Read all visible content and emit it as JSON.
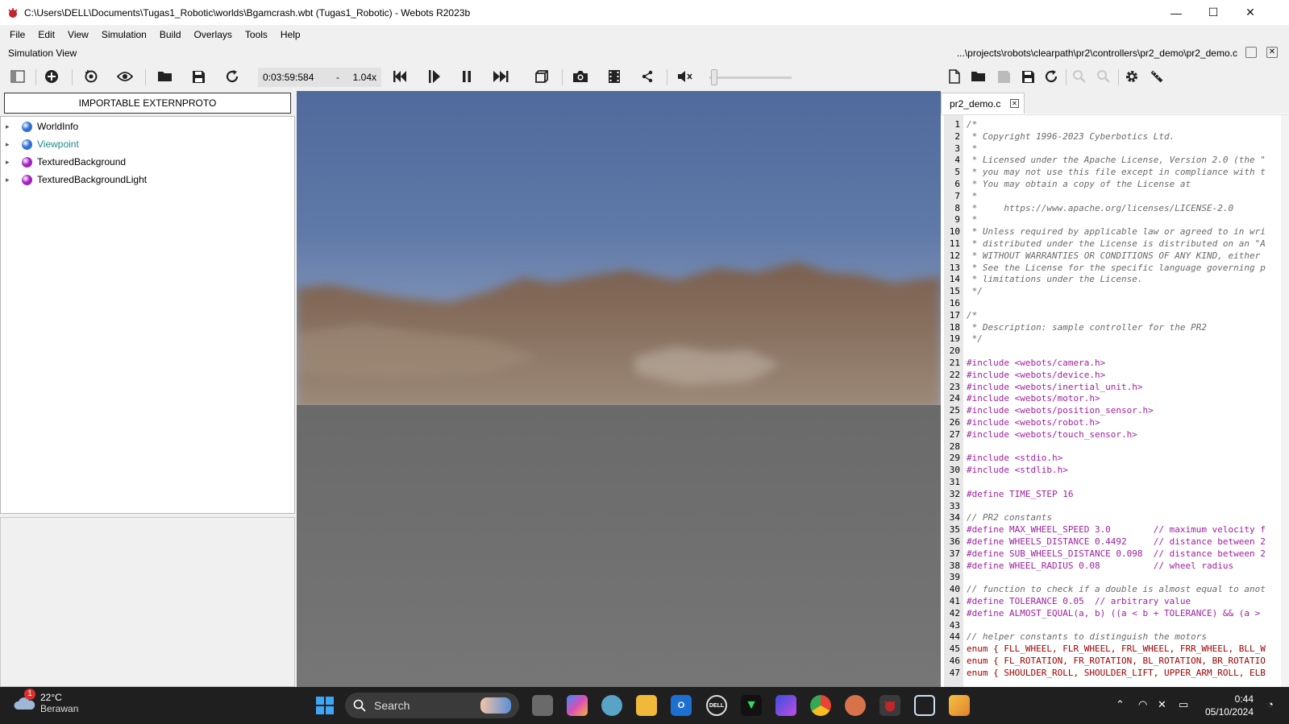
{
  "window": {
    "title": "C:\\Users\\DELL\\Documents\\Tugas1_Robotic\\worlds\\Bgamcrash.wbt (Tugas1_Robotic) - Webots R2023b",
    "minimize": "—",
    "maximize": "☐",
    "close": "✕"
  },
  "menu": [
    "File",
    "Edit",
    "View",
    "Simulation",
    "Build",
    "Overlays",
    "Tools",
    "Help"
  ],
  "simulation_view_label": "Simulation View",
  "editor_path": "...\\projects\\robots\\clearpath\\pr2\\controllers\\pr2_demo\\pr2_demo.c",
  "toolbar": {
    "time": "0:03:59:584",
    "dash": "-",
    "speed": "1.04x",
    "volume_level": 0.02
  },
  "scene_tree": {
    "externproto_button": "IMPORTABLE EXTERNPROTO",
    "items": [
      {
        "label": "WorldInfo",
        "ball_color": "#2f6fd6",
        "label_color": "#000000"
      },
      {
        "label": "Viewpoint",
        "ball_color": "#2f6fd6",
        "label_color": "#1f8a8a"
      },
      {
        "label": "TexturedBackground",
        "ball_color": "#a020c0",
        "label_color": "#000000"
      },
      {
        "label": "TexturedBackgroundLight",
        "ball_color": "#a020c0",
        "label_color": "#000000"
      }
    ]
  },
  "editor": {
    "tab_label": "pr2_demo.c",
    "lines": [
      {
        "n": "1",
        "t": "/*",
        "k": "comment"
      },
      {
        "n": "2",
        "t": " * Copyright 1996-2023 Cyberbotics Ltd.",
        "k": "comment"
      },
      {
        "n": "3",
        "t": " *",
        "k": "comment"
      },
      {
        "n": "4",
        "t": " * Licensed under the Apache License, Version 2.0 (the \"",
        "k": "comment"
      },
      {
        "n": "5",
        "t": " * you may not use this file except in compliance with t",
        "k": "comment"
      },
      {
        "n": "6",
        "t": " * You may obtain a copy of the License at",
        "k": "comment"
      },
      {
        "n": "7",
        "t": " *",
        "k": "comment"
      },
      {
        "n": "8",
        "t": " *     https://www.apache.org/licenses/LICENSE-2.0",
        "k": "comment"
      },
      {
        "n": "9",
        "t": " *",
        "k": "comment"
      },
      {
        "n": "10",
        "t": " * Unless required by applicable law or agreed to in wri",
        "k": "comment"
      },
      {
        "n": "11",
        "t": " * distributed under the License is distributed on an \"A",
        "k": "comment"
      },
      {
        "n": "12",
        "t": " * WITHOUT WARRANTIES OR CONDITIONS OF ANY KIND, either",
        "k": "comment"
      },
      {
        "n": "13",
        "t": " * See the License for the specific language governing p",
        "k": "comment"
      },
      {
        "n": "14",
        "t": " * limitations under the License.",
        "k": "comment"
      },
      {
        "n": "15",
        "t": " */",
        "k": "comment"
      },
      {
        "n": "16",
        "t": "",
        "k": "plain"
      },
      {
        "n": "17",
        "t": "/*",
        "k": "comment"
      },
      {
        "n": "18",
        "t": " * Description: sample controller for the PR2",
        "k": "comment"
      },
      {
        "n": "19",
        "t": " */",
        "k": "comment"
      },
      {
        "n": "20",
        "t": "",
        "k": "plain"
      },
      {
        "n": "21",
        "t": "#include <webots/camera.h>",
        "k": "pp"
      },
      {
        "n": "22",
        "t": "#include <webots/device.h>",
        "k": "pp"
      },
      {
        "n": "23",
        "t": "#include <webots/inertial_unit.h>",
        "k": "pp"
      },
      {
        "n": "24",
        "t": "#include <webots/motor.h>",
        "k": "pp"
      },
      {
        "n": "25",
        "t": "#include <webots/position_sensor.h>",
        "k": "pp"
      },
      {
        "n": "26",
        "t": "#include <webots/robot.h>",
        "k": "pp"
      },
      {
        "n": "27",
        "t": "#include <webots/touch_sensor.h>",
        "k": "pp"
      },
      {
        "n": "28",
        "t": "",
        "k": "plain"
      },
      {
        "n": "29",
        "t": "#include <stdio.h>",
        "k": "pp"
      },
      {
        "n": "30",
        "t": "#include <stdlib.h>",
        "k": "pp"
      },
      {
        "n": "31",
        "t": "",
        "k": "plain"
      },
      {
        "n": "32",
        "t": "#define TIME_STEP 16",
        "k": "pp"
      },
      {
        "n": "33",
        "t": "",
        "k": "plain"
      },
      {
        "n": "34",
        "t": "// PR2 constants",
        "k": "comment"
      },
      {
        "n": "35",
        "t": "#define MAX_WHEEL_SPEED 3.0        // maximum velocity f",
        "k": "pp"
      },
      {
        "n": "36",
        "t": "#define WHEELS_DISTANCE 0.4492     // distance between 2",
        "k": "pp"
      },
      {
        "n": "37",
        "t": "#define SUB_WHEELS_DISTANCE 0.098  // distance between 2",
        "k": "pp"
      },
      {
        "n": "38",
        "t": "#define WHEEL_RADIUS 0.08          // wheel radius",
        "k": "pp"
      },
      {
        "n": "39",
        "t": "",
        "k": "plain"
      },
      {
        "n": "40",
        "t": "// function to check if a double is almost equal to anot",
        "k": "comment"
      },
      {
        "n": "41",
        "t": "#define TOLERANCE 0.05  // arbitrary value",
        "k": "pp"
      },
      {
        "n": "42",
        "t": "#define ALMOST_EQUAL(a, b) ((a < b + TOLERANCE) && (a >",
        "k": "pp"
      },
      {
        "n": "43",
        "t": "",
        "k": "plain"
      },
      {
        "n": "44",
        "t": "// helper constants to distinguish the motors",
        "k": "comment"
      },
      {
        "n": "45",
        "t": "enum { FLL_WHEEL, FLR_WHEEL, FRL_WHEEL, FRR_WHEEL, BLL_W",
        "k": "enum"
      },
      {
        "n": "46",
        "t": "enum { FL_ROTATION, FR_ROTATION, BL_ROTATION, BR_ROTATIO",
        "k": "enum"
      },
      {
        "n": "47",
        "t": "enum { SHOULDER_ROLL, SHOULDER_LIFT, UPPER_ARM_ROLL, ELB",
        "k": "enum"
      }
    ]
  },
  "taskbar": {
    "weather_badge": "1",
    "temperature": "22°C",
    "condition": "Berawan",
    "search_label": "Search",
    "time": "0:44",
    "date": "05/10/2024"
  }
}
